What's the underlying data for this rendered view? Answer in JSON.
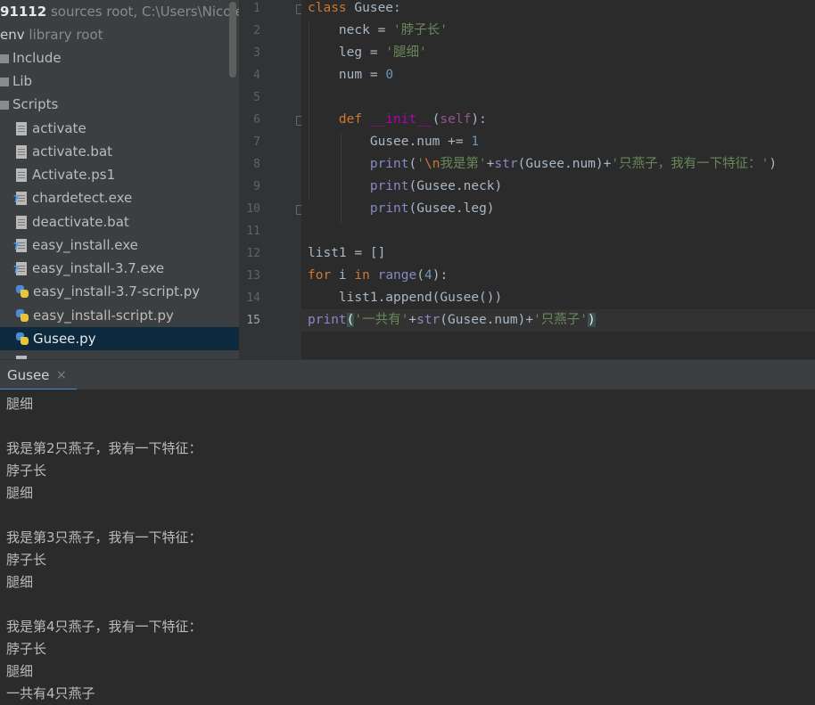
{
  "project": {
    "root": {
      "name": "91112",
      "type": "sources root,",
      "path": "C:\\Users\\Nicole."
    },
    "venv": {
      "name": "env",
      "type": "library root"
    },
    "folders": [
      "Include",
      "Lib",
      "Scripts"
    ],
    "files": [
      {
        "name": "activate",
        "icon": "text-file-icon"
      },
      {
        "name": "activate.bat",
        "icon": "text-file-icon"
      },
      {
        "name": "Activate.ps1",
        "icon": "text-file-icon"
      },
      {
        "name": "chardetect.exe",
        "icon": "unknown-file-icon"
      },
      {
        "name": "deactivate.bat",
        "icon": "text-file-icon"
      },
      {
        "name": "easy_install.exe",
        "icon": "unknown-file-icon"
      },
      {
        "name": "easy_install-3.7.exe",
        "icon": "unknown-file-icon"
      },
      {
        "name": "easy_install-3.7-script.py",
        "icon": "python-file-icon"
      },
      {
        "name": "easy_install-script.py",
        "icon": "python-file-icon"
      },
      {
        "name": "Gusee.py",
        "icon": "python-file-icon"
      }
    ],
    "selected_file": "Gusee.py"
  },
  "editor": {
    "line_numbers": [
      "1",
      "2",
      "3",
      "4",
      "5",
      "6",
      "7",
      "8",
      "9",
      "10",
      "11",
      "12",
      "13",
      "14",
      "15"
    ],
    "current_line": "15",
    "lines": [
      [
        {
          "t": "class ",
          "c": "kw"
        },
        {
          "t": "Gusee:"
        }
      ],
      [
        {
          "t": "    neck = "
        },
        {
          "t": "'脖子长'",
          "c": "str"
        }
      ],
      [
        {
          "t": "    leg = "
        },
        {
          "t": "'腿细'",
          "c": "str"
        }
      ],
      [
        {
          "t": "    num = "
        },
        {
          "t": "0",
          "c": "num"
        }
      ],
      [],
      [
        {
          "t": "    "
        },
        {
          "t": "def ",
          "c": "kw"
        },
        {
          "t": "__init__",
          "c": "mg"
        },
        {
          "t": "("
        },
        {
          "t": "self",
          "c": "sf"
        },
        {
          "t": "):"
        }
      ],
      [
        {
          "t": "        Gusee.num += "
        },
        {
          "t": "1",
          "c": "num"
        }
      ],
      [
        {
          "t": "        "
        },
        {
          "t": "print",
          "c": "bi"
        },
        {
          "t": "("
        },
        {
          "t": "'",
          "c": "str"
        },
        {
          "t": "\\n",
          "c": "esc"
        },
        {
          "t": "我是第'",
          "c": "str"
        },
        {
          "t": "+"
        },
        {
          "t": "str",
          "c": "bi"
        },
        {
          "t": "(Gusee.num)+"
        },
        {
          "t": "'只燕子，我有一下特征：'",
          "c": "str"
        },
        {
          "t": ")"
        }
      ],
      [
        {
          "t": "        "
        },
        {
          "t": "print",
          "c": "bi"
        },
        {
          "t": "(Gusee.neck)"
        }
      ],
      [
        {
          "t": "        "
        },
        {
          "t": "print",
          "c": "bi"
        },
        {
          "t": "(Gusee.leg)"
        }
      ],
      [],
      [
        {
          "t": "list1 = []"
        }
      ],
      [
        {
          "t": "for ",
          "c": "kw"
        },
        {
          "t": "i "
        },
        {
          "t": "in ",
          "c": "kw"
        },
        {
          "t": "range",
          "c": "bi"
        },
        {
          "t": "("
        },
        {
          "t": "4",
          "c": "num"
        },
        {
          "t": "):"
        }
      ],
      [
        {
          "t": "    list1.append(Gusee())"
        }
      ],
      [
        {
          "t": "print",
          "c": "bi"
        },
        {
          "t": "(",
          "c": "bm"
        },
        {
          "t": "'一共有'",
          "c": "str"
        },
        {
          "t": "+"
        },
        {
          "t": "str",
          "c": "bi"
        },
        {
          "t": "(Gusee.num)+"
        },
        {
          "t": "'只燕子'",
          "c": "str"
        },
        {
          "t": ")",
          "c": "bm"
        }
      ]
    ]
  },
  "run": {
    "tab_label": "Gusee",
    "tab_close": "×",
    "output": [
      "腿细",
      "",
      "我是第2只燕子，我有一下特征：",
      "脖子长",
      "腿细",
      "",
      "我是第3只燕子，我有一下特征：",
      "脖子长",
      "腿细",
      "",
      "我是第4只燕子，我有一下特征：",
      "脖子长",
      "腿细",
      "一共有4只燕子"
    ]
  },
  "colors": {
    "keyword": "#cc7832",
    "string": "#6a8759",
    "number": "#6897bb",
    "builtin": "#8888c6",
    "selection": "#0d293e"
  }
}
